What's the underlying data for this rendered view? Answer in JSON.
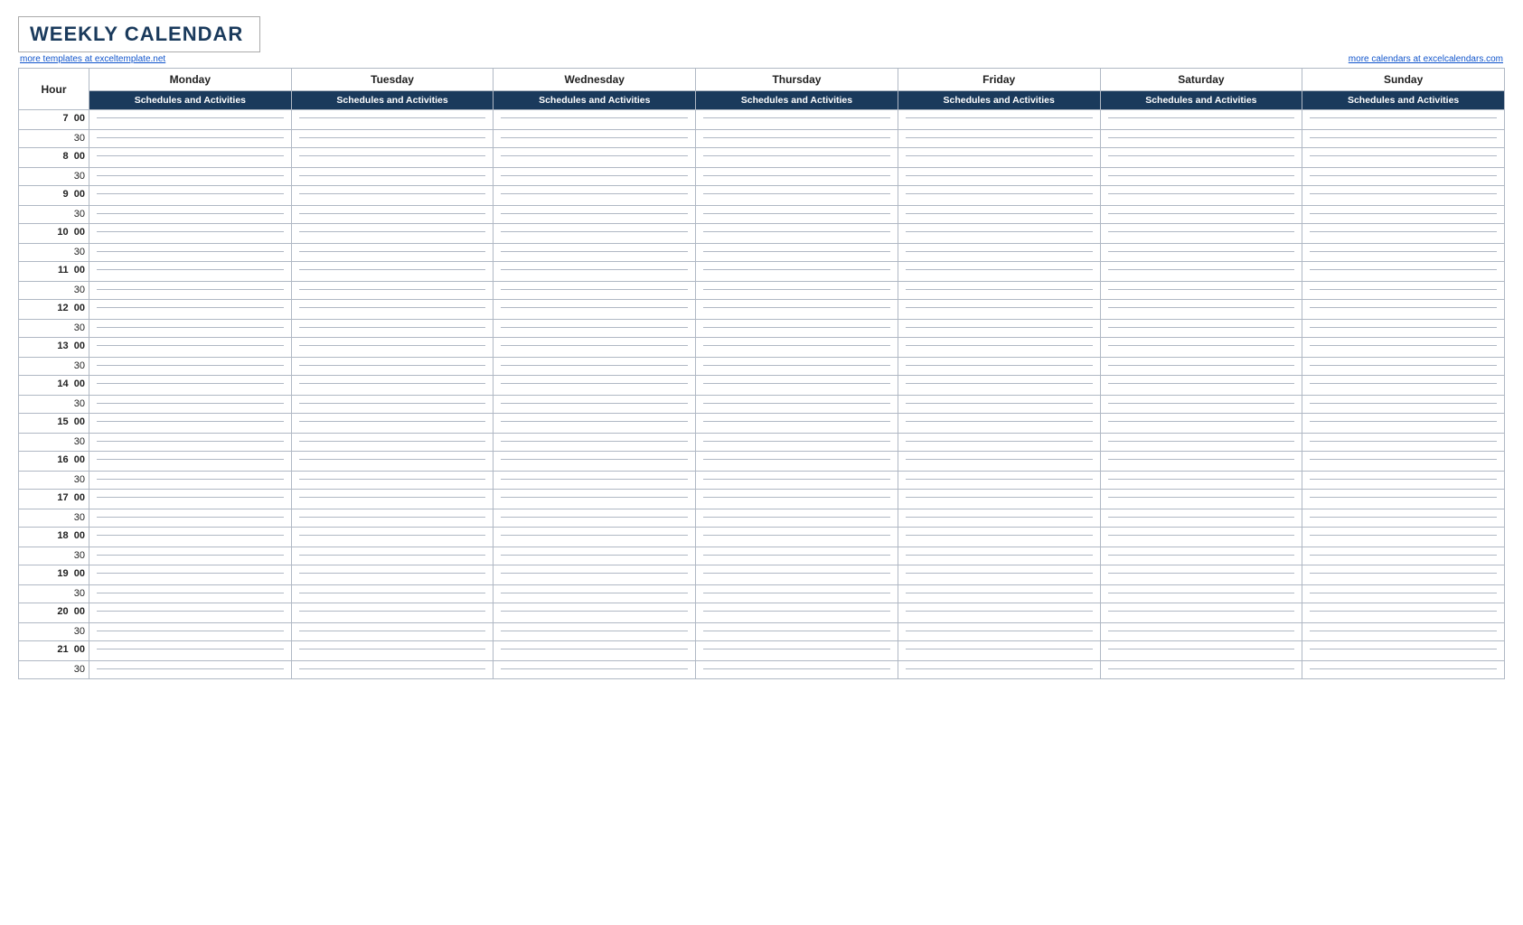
{
  "title": "WEEKLY CALENDAR",
  "link_left": "more templates at exceltemplate.net",
  "link_right": "more calendars at excelcalendars.com",
  "header": {
    "hour_label": "Hour",
    "days": [
      "Monday",
      "Tuesday",
      "Wednesday",
      "Thursday",
      "Friday",
      "Saturday",
      "Sunday"
    ],
    "sub_label": "Schedules and Activities"
  },
  "time_slots": [
    {
      "hour": "7",
      "min": "00"
    },
    {
      "hour": "",
      "min": "30"
    },
    {
      "hour": "8",
      "min": "00"
    },
    {
      "hour": "",
      "min": "30"
    },
    {
      "hour": "9",
      "min": "00"
    },
    {
      "hour": "",
      "min": "30"
    },
    {
      "hour": "10",
      "min": "00"
    },
    {
      "hour": "",
      "min": "30"
    },
    {
      "hour": "11",
      "min": "00"
    },
    {
      "hour": "",
      "min": "30"
    },
    {
      "hour": "12",
      "min": "00"
    },
    {
      "hour": "",
      "min": "30"
    },
    {
      "hour": "13",
      "min": "00"
    },
    {
      "hour": "",
      "min": "30"
    },
    {
      "hour": "14",
      "min": "00"
    },
    {
      "hour": "",
      "min": "30"
    },
    {
      "hour": "15",
      "min": "00"
    },
    {
      "hour": "",
      "min": "30"
    },
    {
      "hour": "16",
      "min": "00"
    },
    {
      "hour": "",
      "min": "30"
    },
    {
      "hour": "17",
      "min": "00"
    },
    {
      "hour": "",
      "min": "30"
    },
    {
      "hour": "18",
      "min": "00"
    },
    {
      "hour": "",
      "min": "30"
    },
    {
      "hour": "19",
      "min": "00"
    },
    {
      "hour": "",
      "min": "30"
    },
    {
      "hour": "20",
      "min": "00"
    },
    {
      "hour": "",
      "min": "30"
    },
    {
      "hour": "21",
      "min": "00"
    },
    {
      "hour": "",
      "min": "30"
    }
  ]
}
